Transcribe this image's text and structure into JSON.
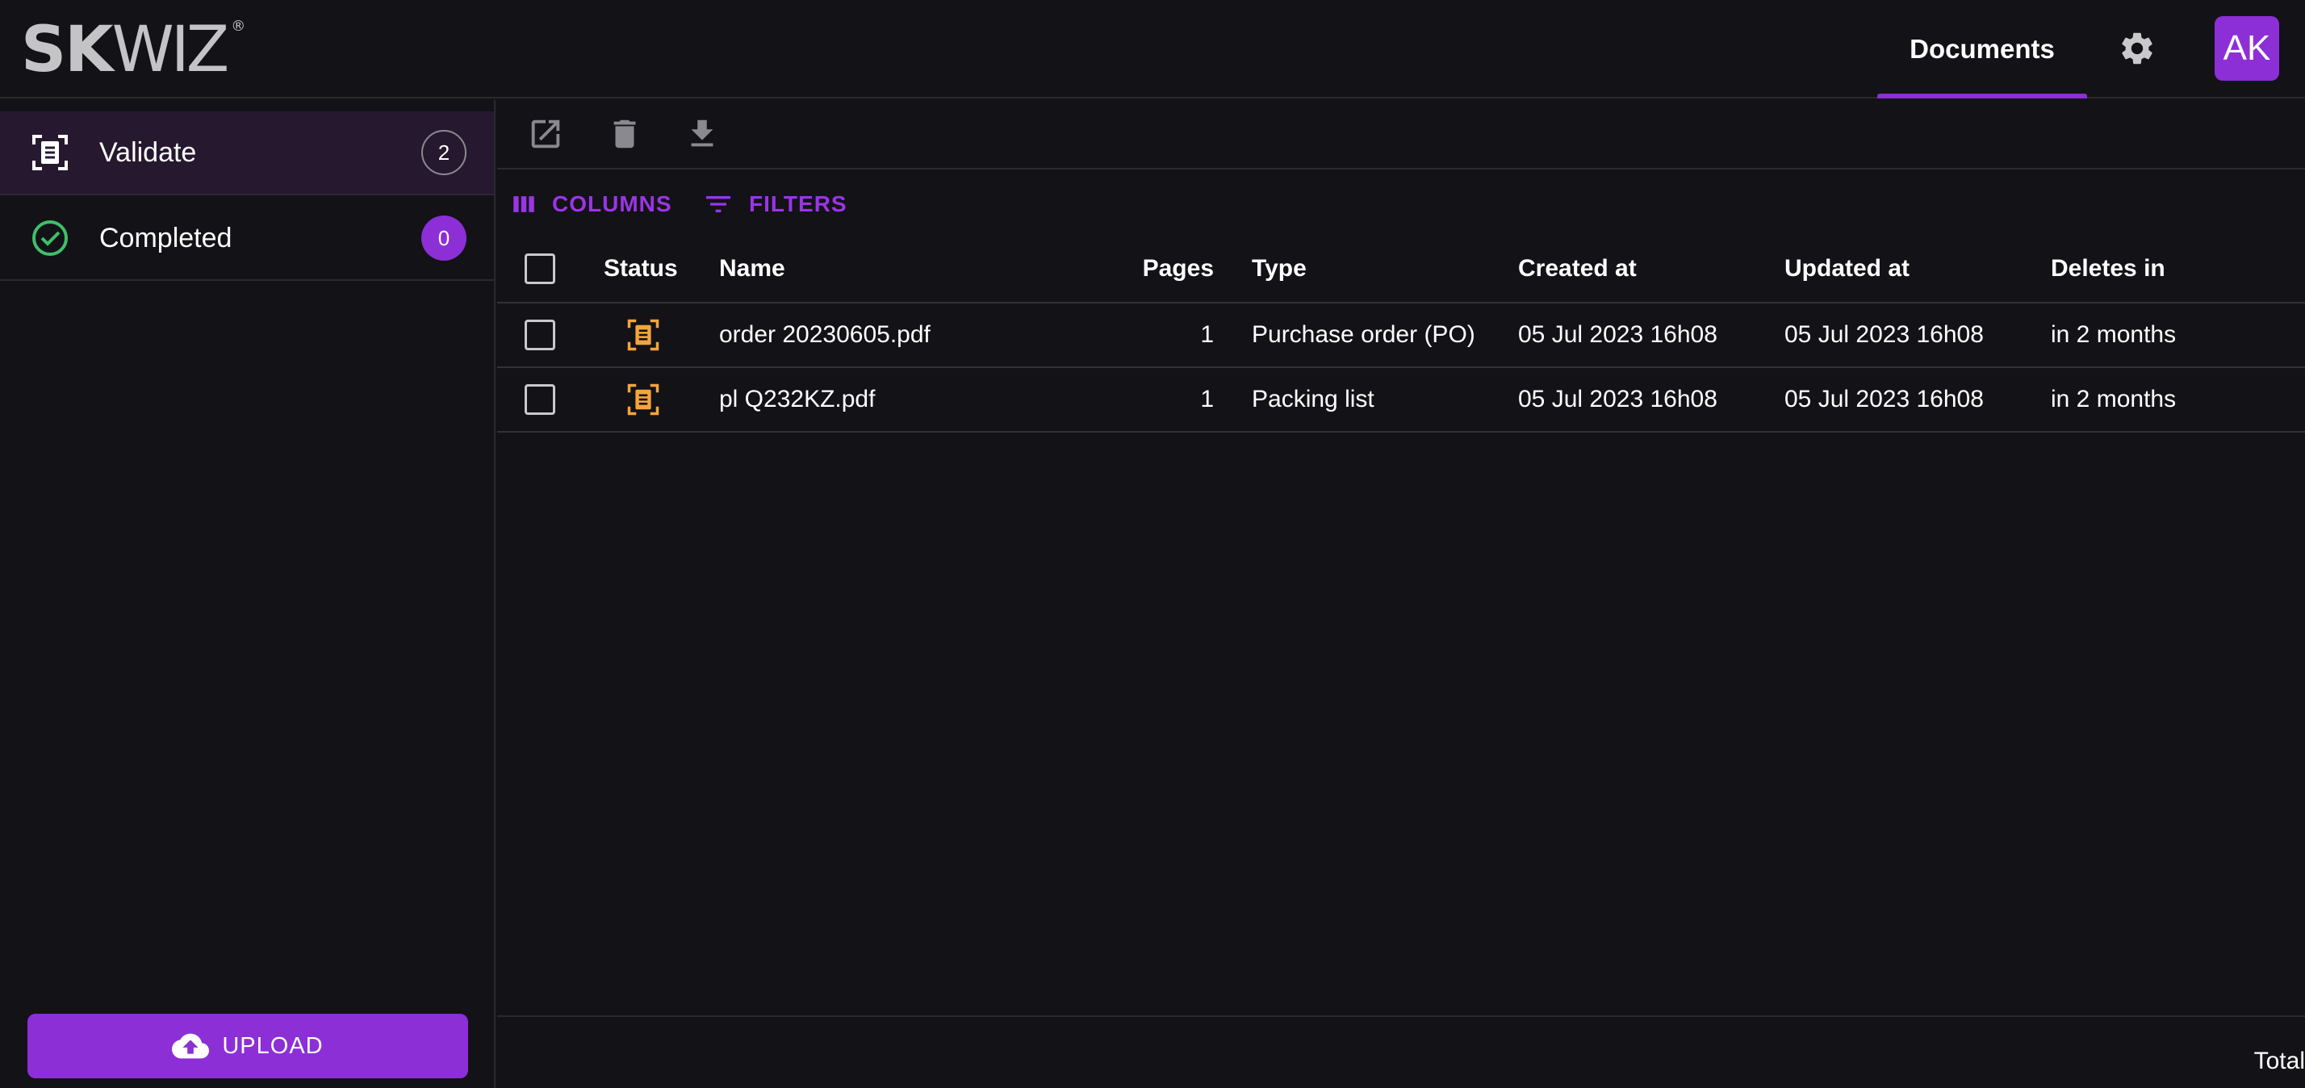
{
  "app": {
    "logo_bold": "SK",
    "logo_light": "WIZ",
    "logo_reg": "®"
  },
  "header": {
    "nav_tab_label": "Documents",
    "avatar_initials": "AK"
  },
  "sidebar": {
    "items": [
      {
        "label": "Validate",
        "count": "2",
        "icon": "document-scan-icon"
      },
      {
        "label": "Completed",
        "count": "0",
        "icon": "check-circle-icon"
      }
    ],
    "upload_label": "UPLOAD"
  },
  "toolbar": {
    "actions": [
      "open-in-new-icon",
      "delete-icon",
      "download-icon"
    ]
  },
  "grid_toolbar": {
    "columns_label": "COLUMNS",
    "filters_label": "FILTERS"
  },
  "table": {
    "columns": [
      "Status",
      "Name",
      "Pages",
      "Type",
      "Created at",
      "Updated at",
      "Deletes in"
    ],
    "rows": [
      {
        "name": "order 20230605.pdf",
        "pages": "1",
        "type": "Purchase order (PO)",
        "created_at": "05 Jul 2023 16h08",
        "updated_at": "05 Jul 2023 16h08",
        "deletes_in": "in 2 months"
      },
      {
        "name": "pl Q232KZ.pdf",
        "pages": "1",
        "type": "Packing list",
        "created_at": "05 Jul 2023 16h08",
        "updated_at": "05 Jul 2023 16h08",
        "deletes_in": "in 2 months"
      }
    ]
  },
  "footer": {
    "total_label": "Total"
  },
  "colors": {
    "accent": "#8c2fd6",
    "background": "#131217",
    "status_pending": "#f3a53b",
    "status_done": "#3fbf6a"
  }
}
